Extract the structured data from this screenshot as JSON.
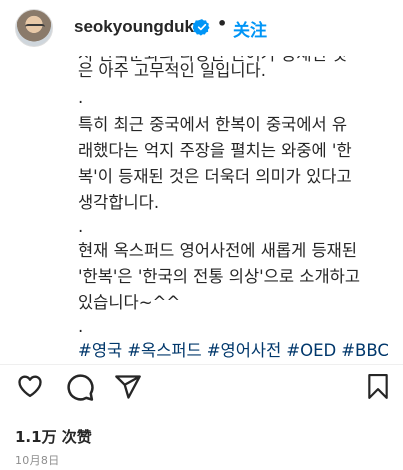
{
  "header": {
    "username": "seokyoungduk",
    "separator": "•",
    "follow_label": "关注"
  },
  "caption": {
    "clipped_line": "시 한국문화의 다양한 단어가 등재된 것",
    "lines": [
      "은 아주 고무적인 일입니다.",
      ".",
      "특히 최근 중국에서 한복이 중국에서 유",
      "래했다는 억지 주장을 펼치는 와중에 '한",
      "복'이 등재된 것은 더욱더 의미가 있다고",
      "생각합니다.",
      ".",
      "현재 옥스퍼드 영어사전에 새롭게 등재된",
      "'한복'은 '한국의 전통 의상'으로 소개하고",
      "있습니다~^^",
      "."
    ],
    "hashtags": [
      "#영국",
      "#옥스퍼드",
      "#영어사전",
      "#OED",
      "#BBC"
    ]
  },
  "actions": {
    "like": "heart-icon",
    "comment": "comment-icon",
    "share": "share-icon",
    "save": "bookmark-icon"
  },
  "likes_text": "1.1万 次赞",
  "date_text": "10月8日",
  "colors": {
    "link": "#00376b",
    "follow": "#0095f6",
    "verified": "#0095f6",
    "muted": "#8e8e8e"
  }
}
